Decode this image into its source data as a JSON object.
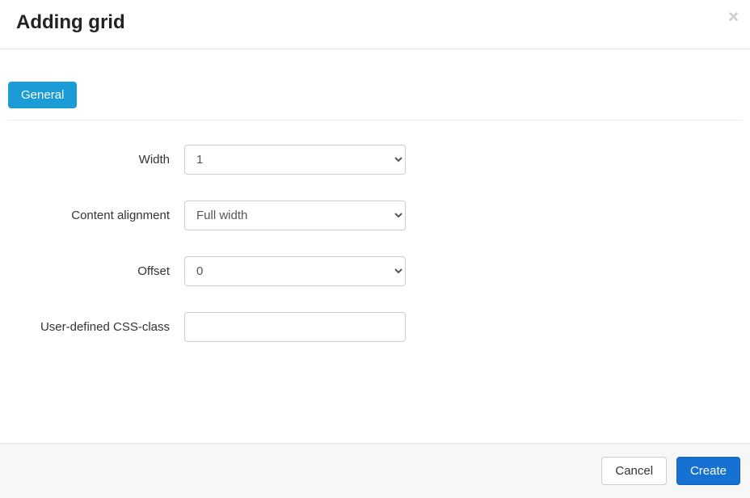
{
  "header": {
    "title": "Adding grid"
  },
  "tabs": {
    "general": "General"
  },
  "form": {
    "width": {
      "label": "Width",
      "value": "1"
    },
    "content_alignment": {
      "label": "Content alignment",
      "value": "Full width"
    },
    "offset": {
      "label": "Offset",
      "value": "0"
    },
    "css_class": {
      "label": "User-defined CSS-class",
      "value": ""
    }
  },
  "footer": {
    "cancel": "Cancel",
    "create": "Create"
  }
}
